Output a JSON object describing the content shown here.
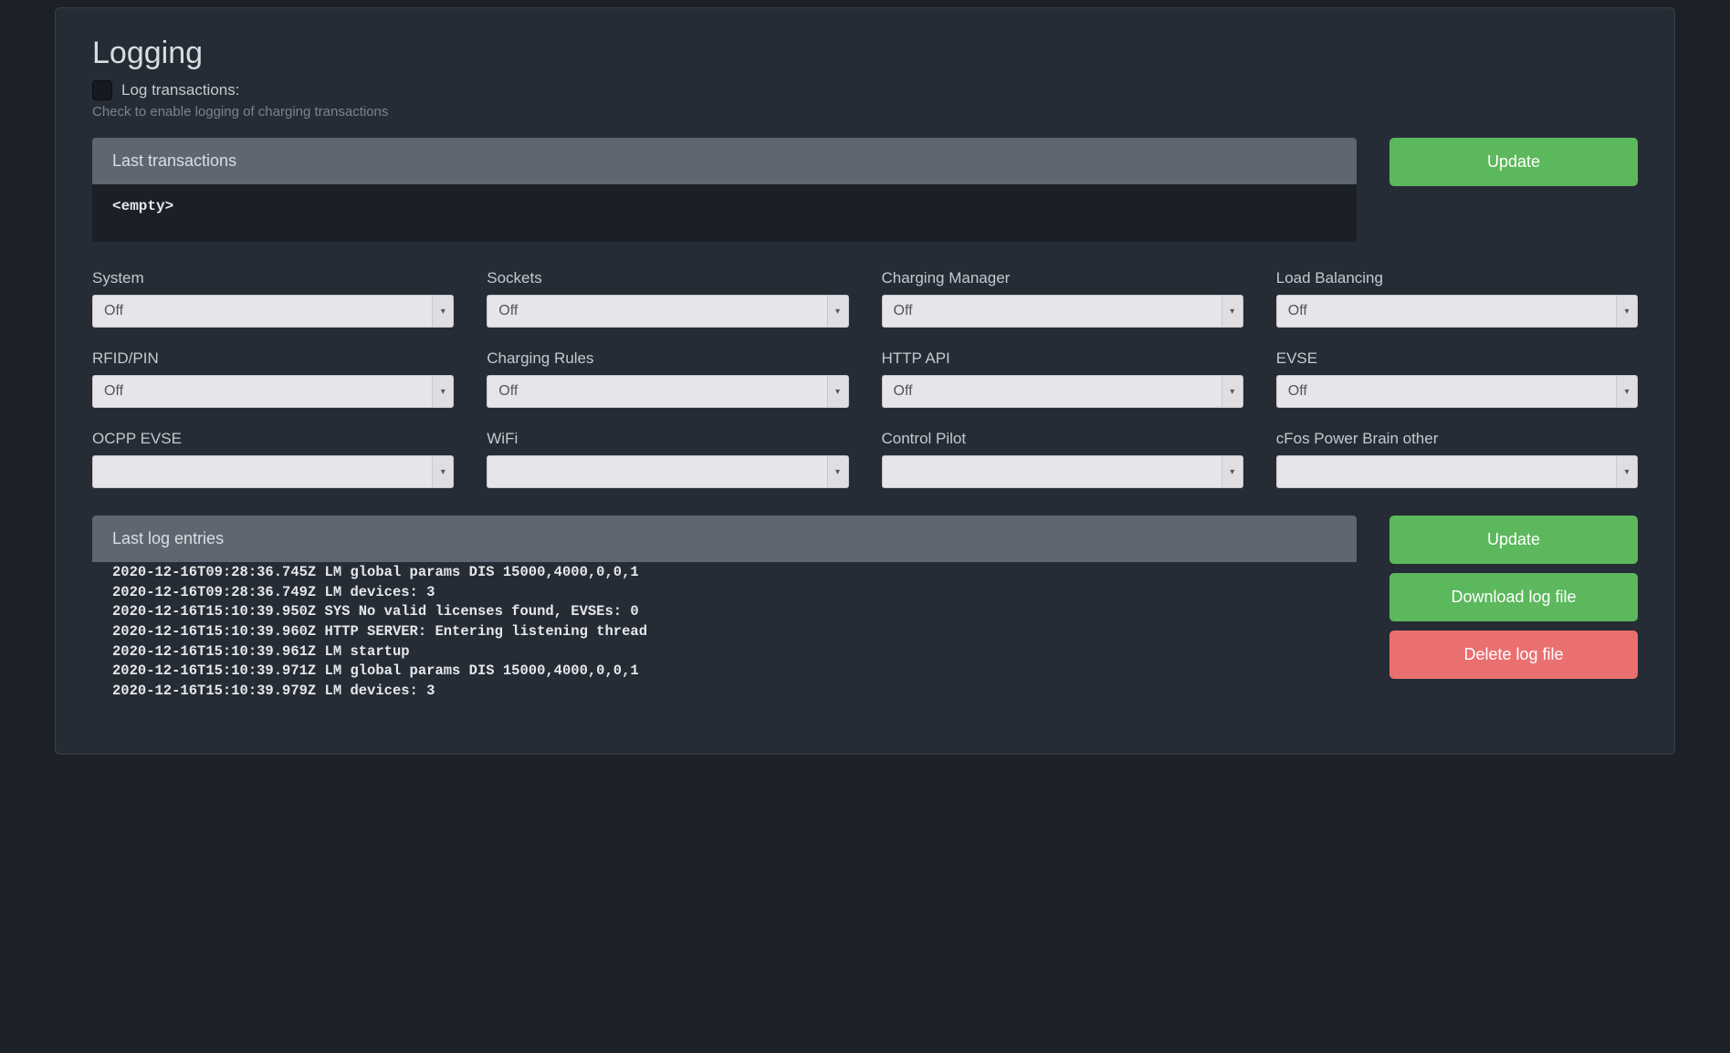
{
  "page_title": "Logging",
  "log_transactions": {
    "label": "Log transactions:",
    "help": "Check to enable logging of charging transactions",
    "checked": false
  },
  "last_transactions": {
    "header": "Last transactions",
    "body": "<empty>"
  },
  "update_button_label": "Update",
  "selects": [
    {
      "label": "System",
      "value": "Off"
    },
    {
      "label": "Sockets",
      "value": "Off"
    },
    {
      "label": "Charging Manager",
      "value": "Off"
    },
    {
      "label": "Load Balancing",
      "value": "Off"
    },
    {
      "label": "RFID/PIN",
      "value": "Off"
    },
    {
      "label": "Charging Rules",
      "value": "Off"
    },
    {
      "label": "HTTP API",
      "value": "Off"
    },
    {
      "label": "EVSE",
      "value": "Off"
    },
    {
      "label": "OCPP EVSE",
      "value": ""
    },
    {
      "label": "WiFi",
      "value": ""
    },
    {
      "label": "Control Pilot",
      "value": ""
    },
    {
      "label": "cFos Power Brain other",
      "value": ""
    }
  ],
  "last_log": {
    "header": "Last log entries",
    "lines": [
      "2020-12-16T09:28:36.745Z LM global params DIS 15000,4000,0,0,1",
      "2020-12-16T09:28:36.749Z LM devices: 3",
      "2020-12-16T15:10:39.950Z SYS No valid licenses found, EVSEs: 0",
      "2020-12-16T15:10:39.960Z HTTP SERVER: Entering listening thread",
      "2020-12-16T15:10:39.961Z LM startup",
      "2020-12-16T15:10:39.971Z LM global params DIS 15000,4000,0,0,1",
      "2020-12-16T15:10:39.979Z LM devices: 3"
    ]
  },
  "log_buttons": {
    "update": "Update",
    "download": "Download log file",
    "delete": "Delete log file"
  }
}
